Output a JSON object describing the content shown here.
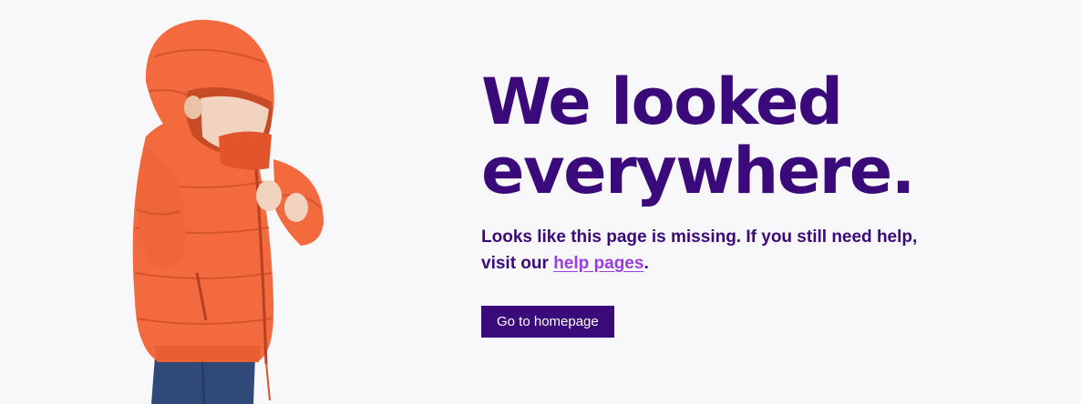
{
  "hero": {
    "headline_line1": "We looked",
    "headline_line2": "everywhere.",
    "message_prefix": "Looks like this page is missing. If you still need help, visit our ",
    "help_link_label": "help pages",
    "message_suffix": ".",
    "home_button_label": "Go to homepage"
  },
  "illustration": {
    "subject": "child-in-orange-puffer-jacket"
  },
  "colors": {
    "background": "#f8f8fa",
    "brand_purple": "#3b0a7a",
    "link_purple": "#9a3de0",
    "jacket_orange": "#f26a3d"
  }
}
